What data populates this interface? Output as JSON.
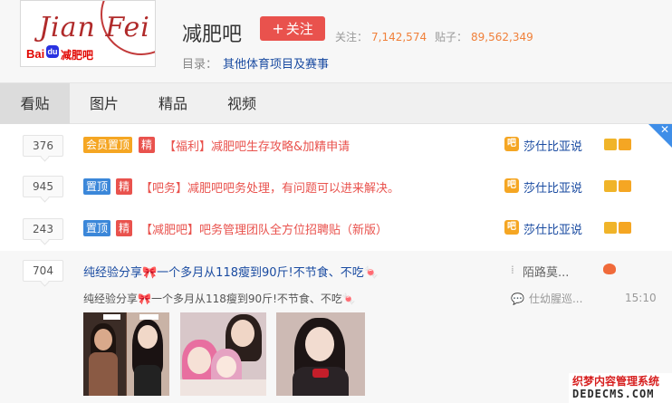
{
  "header": {
    "logo_script": "Jian Fei",
    "logo_bai": "Bai",
    "logo_du": "du",
    "logo_bar": "减肥吧",
    "forum_name": "减肥吧",
    "follow_label": "关注",
    "members_label": "关注：",
    "members_count": "7,142,574",
    "posts_label": "贴子：",
    "posts_count": "89,562,349",
    "catalog_label": "目录：",
    "catalog_value": "其他体育项目及赛事"
  },
  "tabs": [
    {
      "label": "看贴",
      "active": true
    },
    {
      "label": "图片",
      "active": false
    },
    {
      "label": "精品",
      "active": false
    },
    {
      "label": "视频",
      "active": false
    }
  ],
  "threads": [
    {
      "reply_count": "376",
      "tags": [
        "会员置顶",
        "精"
      ],
      "title": "【福利】减肥吧生存攻略&加精申请",
      "author": "莎仕比亚说"
    },
    {
      "reply_count": "945",
      "tags": [
        "置顶",
        "精"
      ],
      "title": "【吧务】减肥吧吧务处理，有问题可以进来解决。",
      "author": "莎仕比亚说"
    },
    {
      "reply_count": "243",
      "tags": [
        "置顶",
        "精"
      ],
      "title": "【减肥吧】吧务管理团队全方位招聘贴（新版）",
      "author": "莎仕比亚说"
    },
    {
      "reply_count": "704",
      "title": "纯经验分享🎀一个多月从118瘦到90斤!不节食、不吃🍬",
      "author": "陌路莫...",
      "abstract": "纯经验分享🎀一个多月从118瘦到90斤!不节食、不吃🍬",
      "last_replier": "仕幼腥巡...",
      "last_time": "15:10"
    }
  ],
  "watermark": {
    "line1": "织梦内容管理系统",
    "line2": "DEDECMS.COM"
  },
  "colors": {
    "accent_red": "#e9524d",
    "link_blue": "#1a4ba1",
    "tag_orange": "#f5a623",
    "tag_blue": "#3b87d9",
    "stat_orange": "#f0803a"
  }
}
